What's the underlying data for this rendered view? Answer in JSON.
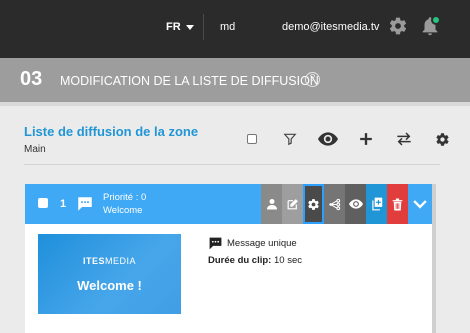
{
  "topbar": {
    "language": "FR",
    "user": "md",
    "email": "demo@itesmedia.tv",
    "icons": [
      "gear-icon",
      "bell-icon"
    ],
    "notification_color": "#26c281"
  },
  "header": {
    "step": "03",
    "title": "MODIFICATION DE LA LISTE DE DIFFUSION",
    "help": "?"
  },
  "section": {
    "title": "Liste de diffusion de la zone",
    "subtitle": "Main",
    "tools": [
      "select-all-checkbox",
      "filter-icon",
      "eye-icon",
      "plus-icon",
      "swap-icon",
      "gear-icon"
    ]
  },
  "item": {
    "index": "1",
    "priority": "Priorité : 0",
    "name": "Welcome",
    "actions": [
      "user-icon",
      "edit-icon",
      "gear-icon",
      "share-icon",
      "eye-icon",
      "copy-icon",
      "trash-icon",
      "chevron-down-icon"
    ],
    "thumbnail": {
      "logo_bold": "ITES",
      "logo_light": "MEDIA",
      "text": "Welcome !"
    },
    "message_type": "Message unique",
    "duration_label": "Durée du clip:",
    "duration_value": "10 sec"
  },
  "colors": {
    "accent": "#3fa9f5",
    "title_blue": "#2196d6",
    "delete_red": "#e23d3d",
    "topbar": "#2b2b2b",
    "band": "#9d9d9d"
  }
}
